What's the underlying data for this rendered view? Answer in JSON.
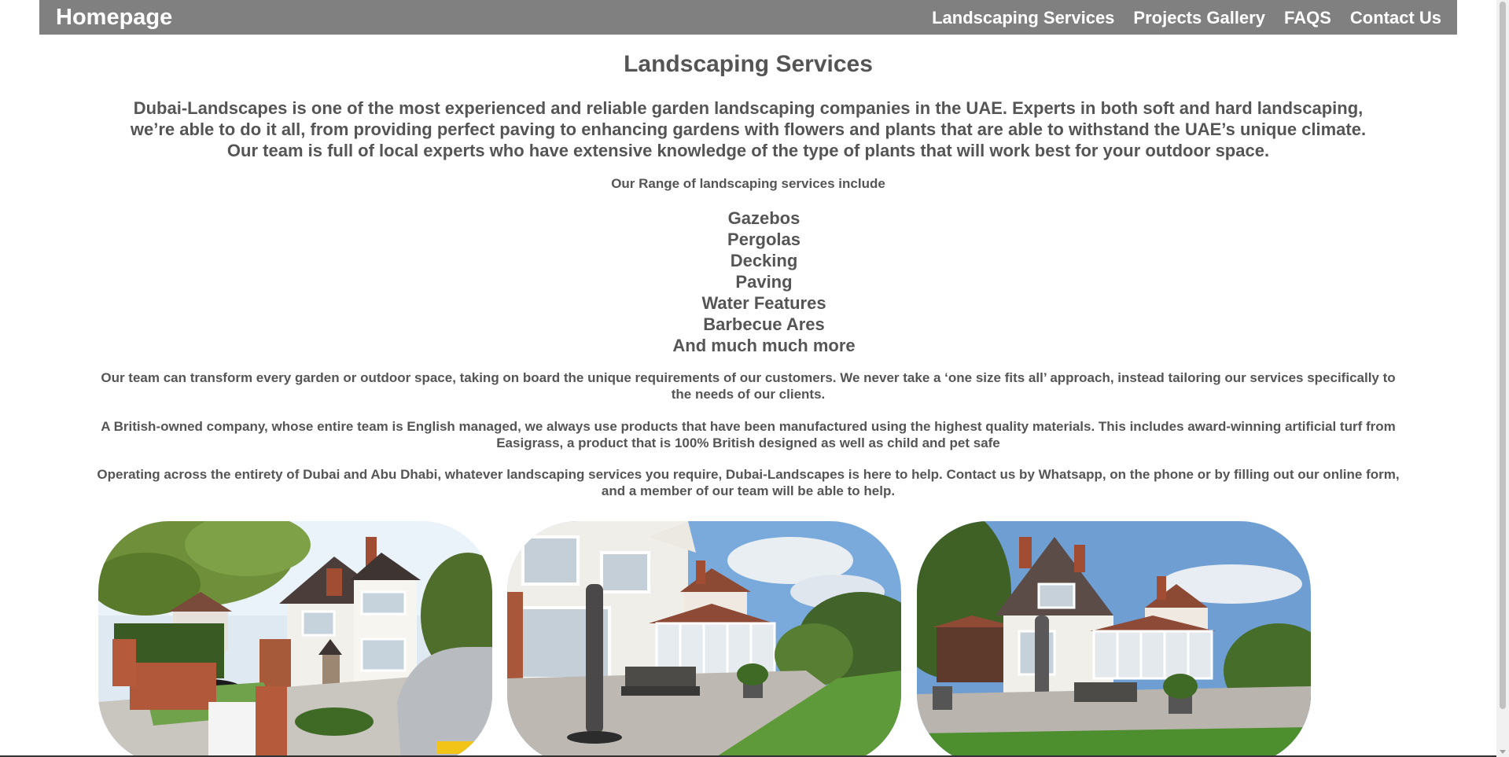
{
  "navbar": {
    "brand": "Homepage",
    "links": [
      "Landscaping Services",
      "Projects Gallery",
      "FAQS",
      "Contact Us"
    ]
  },
  "main": {
    "title": "Landscaping Services",
    "intro": "Dubai-Landscapes is one of the most experienced and reliable garden landscaping companies in the UAE. Experts in both soft and hard landscaping, we’re able to do it all, from providing perfect paving to enhancing gardens with flowers and plants that are able to withstand the UAE’s unique climate. Our team is full of local experts who have extensive knowledge of the type of plants that will work best for your outdoor space.",
    "range_heading": "Our Range of landscaping services include",
    "services": [
      "Gazebos",
      "Pergolas",
      "Decking",
      "Paving",
      "Water Features",
      "Barbecue Ares",
      "And much much more"
    ],
    "paragraphs": [
      "Our team can transform every garden or outdoor space, taking on board the unique requirements of our customers. We never take a ‘one size fits all’ approach, instead tailoring our services specifically to the needs of our clients.",
      "A British-owned company, whose entire team is English managed, we always use products that have been manufactured using the highest quality materials. This includes award-winning artificial turf from Easigrass, a product that is 100% British designed as well as child and pet safe",
      "Operating across the entirety of Dubai and Abu Dhabi, whatever landscaping services you require, Dubai-Landscapes is here to help. Contact us by Whatsapp, on the phone or by filling out our online form, and a member of our team will be able to help."
    ]
  },
  "gallery": {
    "photos": [
      "house-front-photo",
      "patio-garden-photo",
      "rear-house-photo"
    ]
  },
  "colors": {
    "navbar_bg": "#808080",
    "text": "#555555",
    "nav_text": "#ffffff"
  }
}
